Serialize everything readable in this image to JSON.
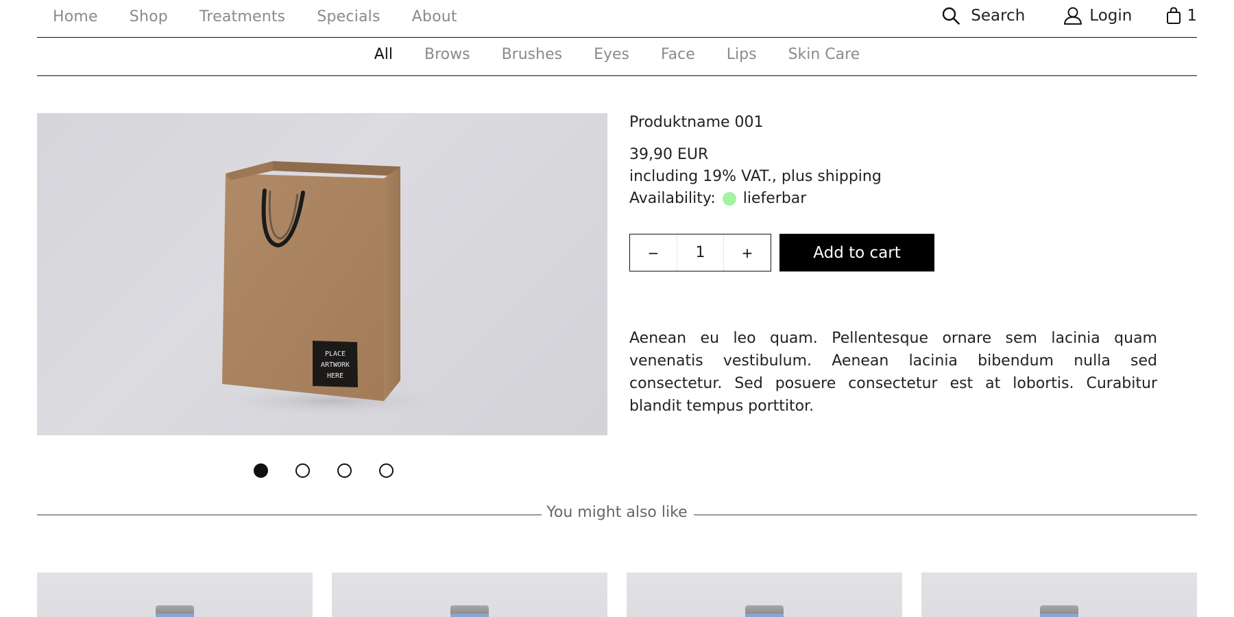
{
  "topnav": {
    "links": [
      "Home",
      "Shop",
      "Treatments",
      "Specials",
      "About"
    ],
    "search_label": "Search",
    "login_label": "Login",
    "cart_count": "1"
  },
  "catnav": {
    "links": [
      "All",
      "Brows",
      "Brushes",
      "Eyes",
      "Face",
      "Lips",
      "Skin Care"
    ],
    "active": "All"
  },
  "product": {
    "image_text": [
      "PLACE",
      "ARTWORK",
      "HERE"
    ],
    "name": "Produktname 001",
    "price": "39,90 EUR",
    "vat": "including 19% VAT., plus shipping",
    "availability_label": "Availability:",
    "availability_value": "lieferbar",
    "availability_color": "#a3f3a3",
    "quantity": "1",
    "minus": "−",
    "plus": "+",
    "add_to_cart": "Add to cart",
    "description": "Aenean eu leo quam. Pellentesque ornare sem lacinia quam venenatis vestibulum. Aenean lacinia bibendum nulla sed consectetur. Sed posuere consectetur est at lobortis. Curabitur blandit tempus porttitor.",
    "gallery_count": 4,
    "gallery_active": 1
  },
  "related": {
    "heading": "You might also like",
    "count": 4
  }
}
